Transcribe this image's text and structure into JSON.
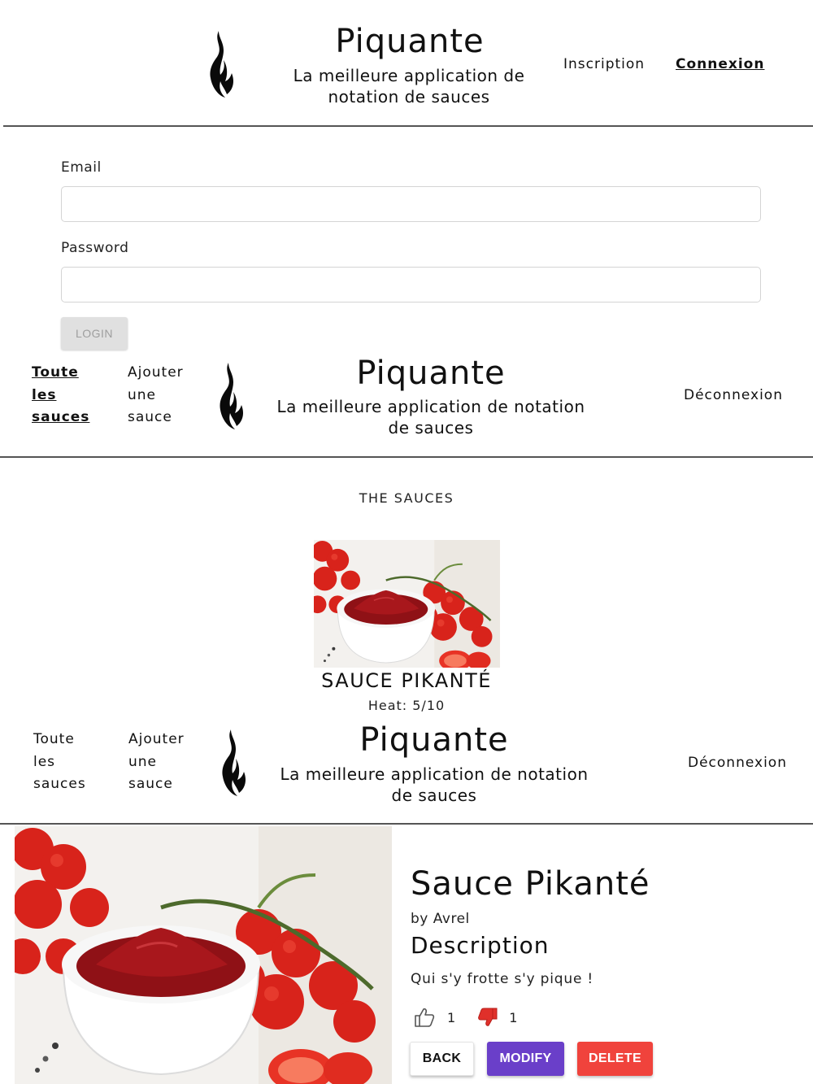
{
  "brand": {
    "title": "Piquante",
    "subtitle_short": [
      "La meilleure application de",
      "notation de sauces"
    ],
    "subtitle_long": [
      "La meilleure application de notation",
      "de sauces"
    ]
  },
  "header1": {
    "nav": [
      "Inscription",
      "Connexion"
    ],
    "active": "Connexion"
  },
  "login": {
    "email_label": "Email",
    "email_value": "",
    "password_label": "Password",
    "password_value": "",
    "login_label": "LOGIN"
  },
  "header2": {
    "nav_all": [
      "Toute",
      "les",
      "sauces"
    ],
    "nav_add": [
      "Ajouter",
      "une",
      "sauce"
    ],
    "logout": "Déconnexion"
  },
  "sauces": {
    "title": "THE SAUCES",
    "items": [
      {
        "name": "SAUCE PIKANTÉ",
        "heat": "Heat: 5/10"
      }
    ]
  },
  "header3": {
    "nav_all": [
      "Toute",
      "les",
      "sauces"
    ],
    "nav_add": [
      "Ajouter",
      "une",
      "sauce"
    ],
    "logout": "Déconnexion"
  },
  "detail": {
    "name": "Sauce Pikanté",
    "by": "by Avrel",
    "description_heading": "Description",
    "description": "Qui s'y frotte s'y pique !",
    "likes": "1",
    "dislikes": "1",
    "back_label": "BACK",
    "modify_label": "MODIFY",
    "delete_label": "DELETE"
  },
  "colors": {
    "modify": "#6a3fc9",
    "delete": "#f0433c",
    "dislike": "#e0302a",
    "rule": "#555555"
  }
}
